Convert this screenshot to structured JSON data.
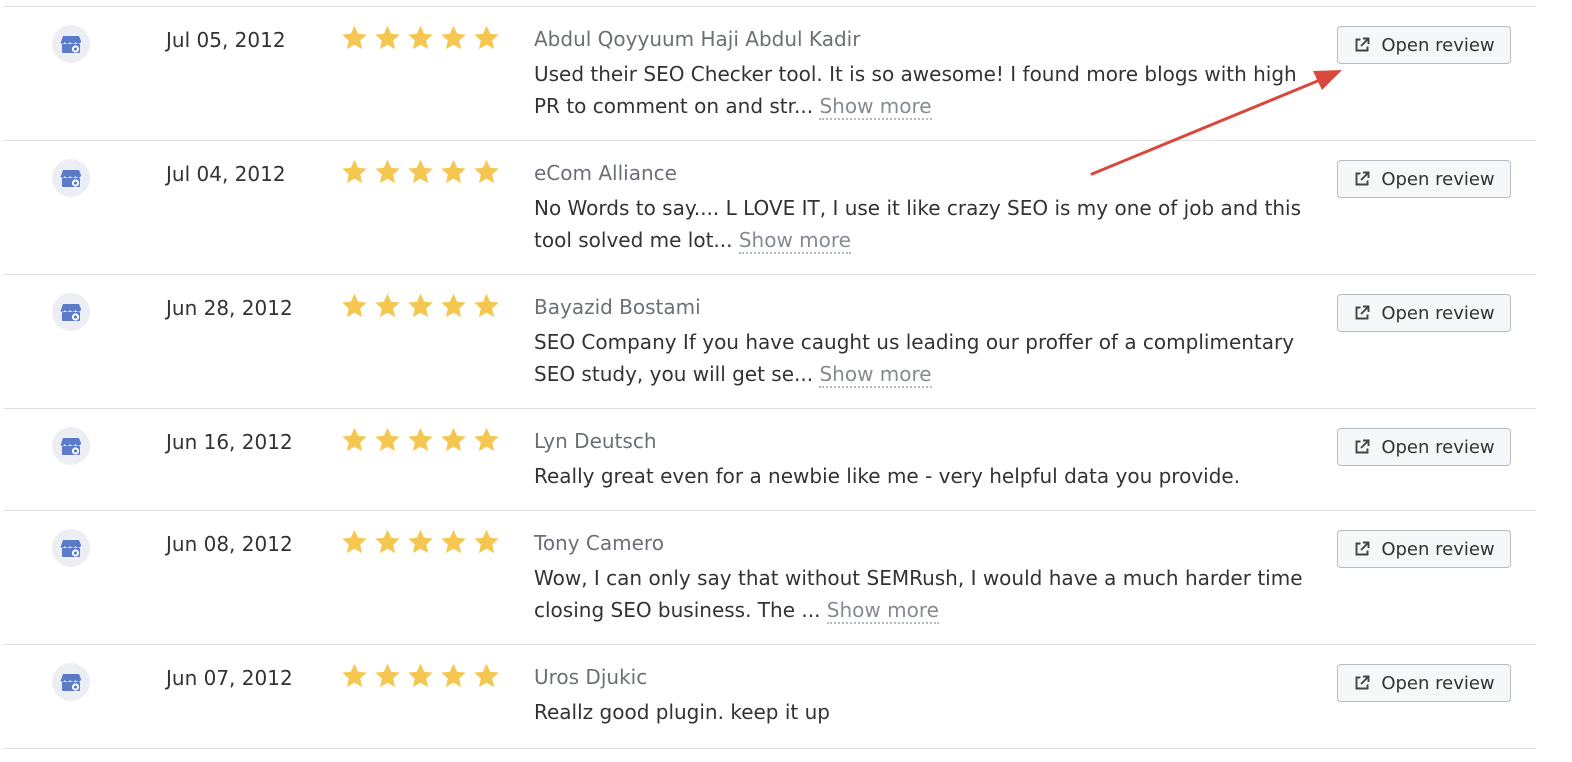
{
  "reviews": [
    {
      "date": "Jul 05, 2012",
      "rating": 5,
      "author": "Abdul Qoyyuum Haji Abdul Kadir",
      "text": "Used their SEO Checker tool. It is so awesome! I found more blogs with high PR to comment on and str...",
      "show_more": "Show more",
      "button": "Open review"
    },
    {
      "date": "Jul 04, 2012",
      "rating": 5,
      "author": "eCom Alliance",
      "text": "No Words to say.... L LOVE IT, I use it like crazy SEO is my one of job and this tool solved me lot...",
      "show_more": "Show more",
      "button": "Open review"
    },
    {
      "date": "Jun 28, 2012",
      "rating": 5,
      "author": "Bayazid Bostami",
      "text": "SEO Company If you have caught us leading our proffer of a complimentary SEO study, you will get se...",
      "show_more": "Show more",
      "button": "Open review"
    },
    {
      "date": "Jun 16, 2012",
      "rating": 5,
      "author": "Lyn Deutsch",
      "text": "Really great even for a newbie like me - very helpful data you provide.",
      "show_more": "",
      "button": "Open review"
    },
    {
      "date": "Jun 08, 2012",
      "rating": 5,
      "author": "Tony Camero",
      "text": "Wow, I can only say that without SEMRush, I would have a much harder time closing SEO business. The ...",
      "show_more": "Show more",
      "button": "Open review"
    },
    {
      "date": "Jun 07, 2012",
      "rating": 5,
      "author": "Uros Djukic",
      "text": "Reallz good plugin. keep it up",
      "show_more": "",
      "button": "Open review"
    }
  ],
  "source_icon": "store-icon",
  "colors": {
    "star": "#f5c750",
    "arrow": "#d9483b",
    "source_icon": "#5b7bc9"
  }
}
